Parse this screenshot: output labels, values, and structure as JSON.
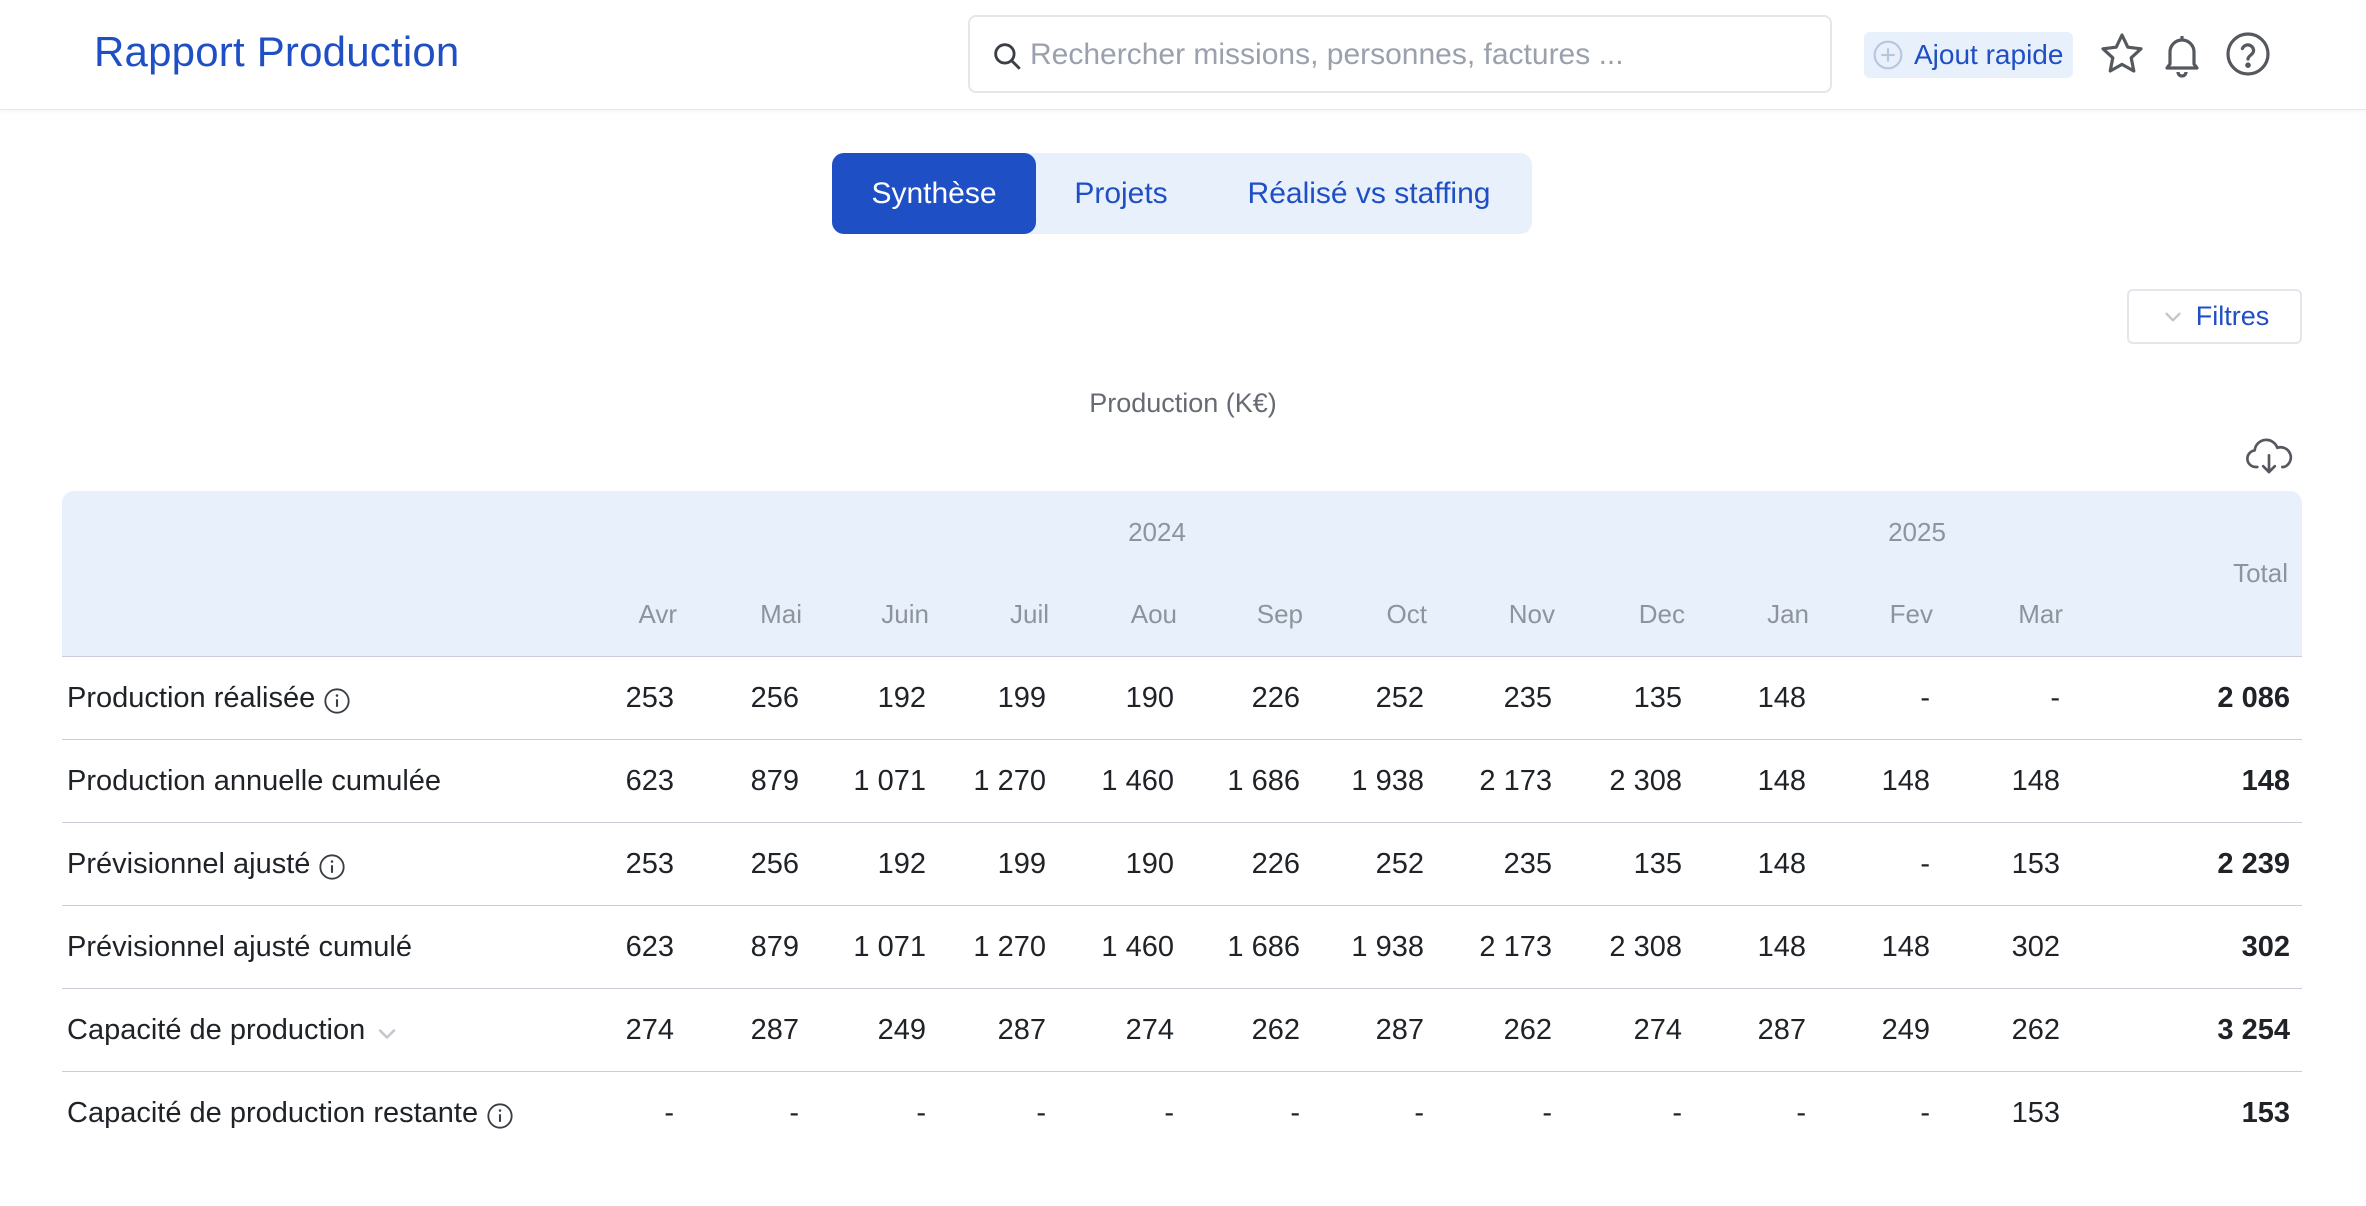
{
  "header": {
    "title": "Rapport Production",
    "search_placeholder": "Rechercher missions, personnes, factures ...",
    "quick_add_label": "Ajout rapide",
    "icons": [
      "search-icon",
      "plus-circle-icon",
      "star-icon",
      "bell-icon",
      "help-icon"
    ]
  },
  "tabs": [
    {
      "label": "Synthèse",
      "active": true
    },
    {
      "label": "Projets",
      "active": false
    },
    {
      "label": "Réalisé vs staffing",
      "active": false
    }
  ],
  "filters_label": "Filtres",
  "table": {
    "caption": "Production (K€)",
    "years": [
      "2024",
      "2025"
    ],
    "months": [
      "Avr",
      "Mai",
      "Juin",
      "Juil",
      "Aou",
      "Sep",
      "Oct",
      "Nov",
      "Dec",
      "Jan",
      "Fev",
      "Mar"
    ],
    "total_label": "Total",
    "rows": [
      {
        "label": "Production réalisée",
        "icon": "info-icon",
        "values": [
          "253",
          "256",
          "192",
          "199",
          "190",
          "226",
          "252",
          "235",
          "135",
          "148",
          "-",
          "-"
        ],
        "total": "2 086"
      },
      {
        "label": "Production annuelle cumulée",
        "icon": "",
        "values": [
          "623",
          "879",
          "1 071",
          "1 270",
          "1 460",
          "1 686",
          "1 938",
          "2 173",
          "2 308",
          "148",
          "148",
          "148"
        ],
        "total": "148"
      },
      {
        "label": "Prévisionnel ajusté",
        "icon": "info-icon",
        "values": [
          "253",
          "256",
          "192",
          "199",
          "190",
          "226",
          "252",
          "235",
          "135",
          "148",
          "-",
          "153"
        ],
        "total": "2 239"
      },
      {
        "label": "Prévisionnel ajusté cumulé",
        "icon": "",
        "values": [
          "623",
          "879",
          "1 071",
          "1 270",
          "1 460",
          "1 686",
          "1 938",
          "2 173",
          "2 308",
          "148",
          "148",
          "302"
        ],
        "total": "302"
      },
      {
        "label": "Capacité de production",
        "icon": "chevron-down-icon",
        "values": [
          "274",
          "287",
          "249",
          "287",
          "274",
          "262",
          "287",
          "262",
          "274",
          "287",
          "249",
          "262"
        ],
        "total": "3 254"
      },
      {
        "label": "Capacité de production restante",
        "icon": "info-icon",
        "values": [
          "-",
          "-",
          "-",
          "-",
          "-",
          "-",
          "-",
          "-",
          "-",
          "-",
          "-",
          "153"
        ],
        "total": "153"
      }
    ]
  },
  "colors": {
    "brand": "#1f4fc4",
    "header_bg": "#e8f0fb",
    "muted_text": "#8e949d"
  }
}
